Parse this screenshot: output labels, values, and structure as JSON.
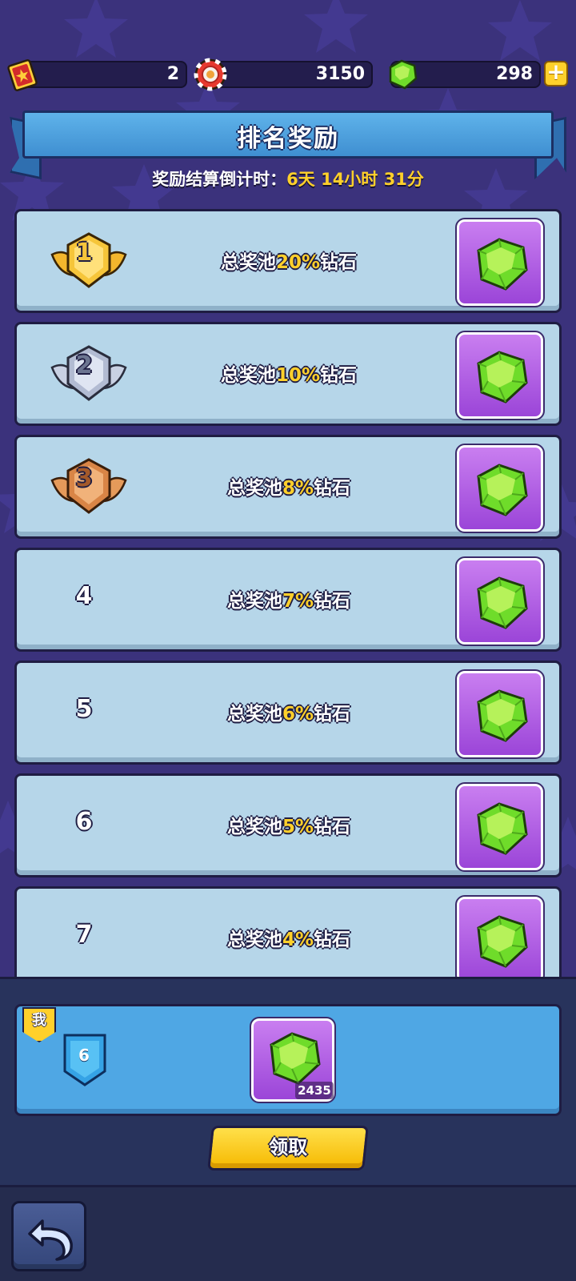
{
  "currency": {
    "tickets": "2",
    "chips": "3150",
    "gems": "298",
    "plus_label": "+"
  },
  "header": {
    "title": "排名奖励",
    "countdown_label": "奖励结算倒计时：",
    "countdown_value": "6天 14小时 31分"
  },
  "rewards": [
    {
      "rank": "1",
      "prefix": "总奖池",
      "pct": "20%",
      "suffix": "钻石"
    },
    {
      "rank": "2",
      "prefix": "总奖池",
      "pct": "10%",
      "suffix": "钻石"
    },
    {
      "rank": "3",
      "prefix": "总奖池",
      "pct": "8%",
      "suffix": "钻石"
    },
    {
      "rank": "4",
      "prefix": "总奖池",
      "pct": "7%",
      "suffix": "钻石"
    },
    {
      "rank": "5",
      "prefix": "总奖池",
      "pct": "6%",
      "suffix": "钻石"
    },
    {
      "rank": "6",
      "prefix": "总奖池",
      "pct": "5%",
      "suffix": "钻石"
    },
    {
      "rank": "7",
      "prefix": "总奖池",
      "pct": "4%",
      "suffix": "钻石"
    }
  ],
  "my": {
    "badge": "我",
    "rank": "6",
    "gem_amount": "2435",
    "claim_label": "领取"
  },
  "icons": {
    "ticket": "ticket-icon",
    "chip": "chip-icon",
    "gem": "gem-icon",
    "back": "back-arrow-icon"
  },
  "colors": {
    "accent_yellow": "#ffd02b",
    "gem_green": "#6fdc2a",
    "row_bg": "#b6d6e9",
    "my_panel": "#4fa7e4"
  }
}
